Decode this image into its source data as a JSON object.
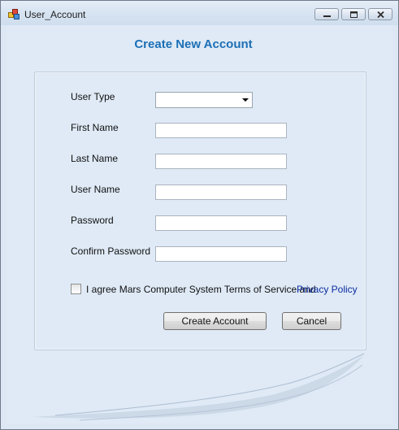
{
  "window": {
    "title": "User_Account"
  },
  "form": {
    "heading": "Create New Account",
    "fields": {
      "user_type": {
        "label": "User Type",
        "value": ""
      },
      "first_name": {
        "label": "First Name",
        "value": ""
      },
      "last_name": {
        "label": "Last Name",
        "value": ""
      },
      "user_name": {
        "label": "User Name",
        "value": ""
      },
      "password": {
        "label": "Password",
        "value": ""
      },
      "confirm_password": {
        "label": "Confirm Password",
        "value": ""
      }
    },
    "agreement": {
      "text": "I agree Mars Computer System Terms of Service and",
      "link": "Privacy Policy",
      "checked": false
    },
    "buttons": {
      "create": "Create Account",
      "cancel": "Cancel"
    }
  },
  "colors": {
    "heading": "#1c6fb5",
    "background": "#dfeaf6",
    "link": "#0a2ca0"
  },
  "icons": {
    "app": "app-window-icon",
    "minimize": "minimize-icon",
    "maximize": "maximize-icon",
    "close": "close-icon",
    "dropdown": "chevron-down-icon"
  }
}
